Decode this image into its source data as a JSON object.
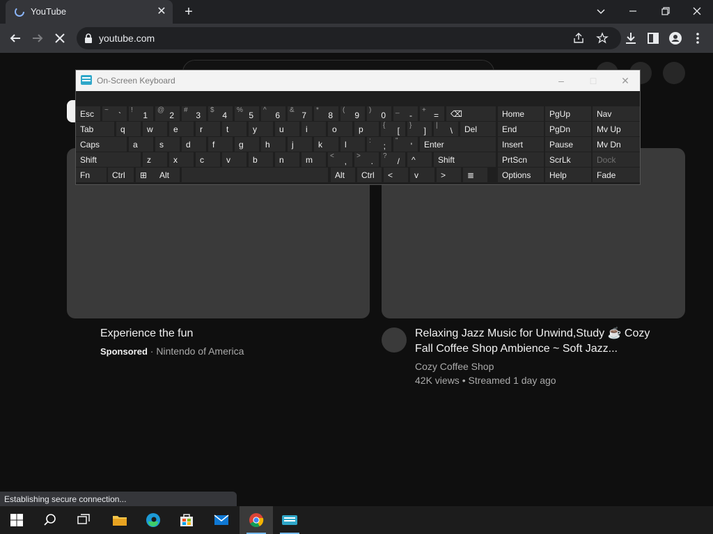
{
  "browser": {
    "tab_title": "YouTube",
    "url": "youtube.com"
  },
  "page": {
    "videos": [
      {
        "title": "Experience the fun",
        "sponsored_label": "Sponsored",
        "separator": "·",
        "channel": "Nintendo of America"
      },
      {
        "title_line1": "Relaxing Jazz Music for Unwind,Study ☕ Cozy",
        "title_line2": "Fall Coffee Shop Ambience ~ Soft Jazz...",
        "channel": "Cozy Coffee Shop",
        "stats": "42K views • Streamed 1 day ago"
      }
    ]
  },
  "status_bar": {
    "text": "Establishing secure connection..."
  },
  "keyboard": {
    "title": "On-Screen Keyboard",
    "keys": [
      {
        "label": "Esc"
      },
      {
        "top": "~",
        "bot": "`"
      },
      {
        "top": "!",
        "bot": "1"
      },
      {
        "top": "@",
        "bot": "2"
      },
      {
        "top": "#",
        "bot": "3"
      },
      {
        "top": "$",
        "bot": "4"
      },
      {
        "top": "%",
        "bot": "5"
      },
      {
        "top": "^",
        "bot": "6"
      },
      {
        "top": "&",
        "bot": "7"
      },
      {
        "top": "*",
        "bot": "8"
      },
      {
        "top": "(",
        "bot": "9"
      },
      {
        "top": ")",
        "bot": "0"
      },
      {
        "top": "_",
        "bot": "-"
      },
      {
        "top": "+",
        "bot": "="
      },
      {
        "label": "⌫"
      },
      {
        "label": "Home"
      },
      {
        "label": "PgUp"
      },
      {
        "label": "Nav"
      },
      {
        "label": "Tab"
      },
      {
        "label": "q"
      },
      {
        "label": "w"
      },
      {
        "label": "e"
      },
      {
        "label": "r"
      },
      {
        "label": "t"
      },
      {
        "label": "y"
      },
      {
        "label": "u"
      },
      {
        "label": "i"
      },
      {
        "label": "o"
      },
      {
        "label": "p"
      },
      {
        "top": "{",
        "bot": "["
      },
      {
        "top": "}",
        "bot": "]"
      },
      {
        "top": "|",
        "bot": "\\"
      },
      {
        "label": "Del"
      },
      {
        "label": "End"
      },
      {
        "label": "PgDn"
      },
      {
        "label": "Mv Up"
      },
      {
        "label": "Caps"
      },
      {
        "label": "a"
      },
      {
        "label": "s"
      },
      {
        "label": "d"
      },
      {
        "label": "f"
      },
      {
        "label": "g"
      },
      {
        "label": "h"
      },
      {
        "label": "j"
      },
      {
        "label": "k"
      },
      {
        "label": "l"
      },
      {
        "top": ":",
        "bot": ";"
      },
      {
        "top": "\"",
        "bot": "'"
      },
      {
        "label": "Enter"
      },
      {
        "label": "Insert"
      },
      {
        "label": "Pause"
      },
      {
        "label": "Mv Dn"
      },
      {
        "label": "Shift"
      },
      {
        "label": "z"
      },
      {
        "label": "x"
      },
      {
        "label": "c"
      },
      {
        "label": "v"
      },
      {
        "label": "b"
      },
      {
        "label": "n"
      },
      {
        "label": "m"
      },
      {
        "top": "<",
        "bot": ","
      },
      {
        "top": ">",
        "bot": "."
      },
      {
        "top": "?",
        "bot": "/"
      },
      {
        "label": "^"
      },
      {
        "label": "Shift"
      },
      {
        "label": "PrtScn"
      },
      {
        "label": "ScrLk"
      },
      {
        "label": "Dock"
      },
      {
        "label": "Fn"
      },
      {
        "label": "Ctrl"
      },
      {
        "label": "⊞"
      },
      {
        "label": "Alt"
      },
      {
        "label": ""
      },
      {
        "label": "Alt"
      },
      {
        "label": "Ctrl"
      },
      {
        "label": "<"
      },
      {
        "label": "v"
      },
      {
        "label": ">"
      },
      {
        "label": "≣"
      },
      {
        "label": "Options"
      },
      {
        "label": "Help"
      },
      {
        "label": "Fade"
      }
    ]
  },
  "taskbar": {
    "icons": [
      "windows-start-icon",
      "search-icon",
      "task-view-icon",
      "file-explorer-icon",
      "edge-icon",
      "store-icon",
      "mail-icon",
      "chrome-icon",
      "osk-icon"
    ]
  }
}
